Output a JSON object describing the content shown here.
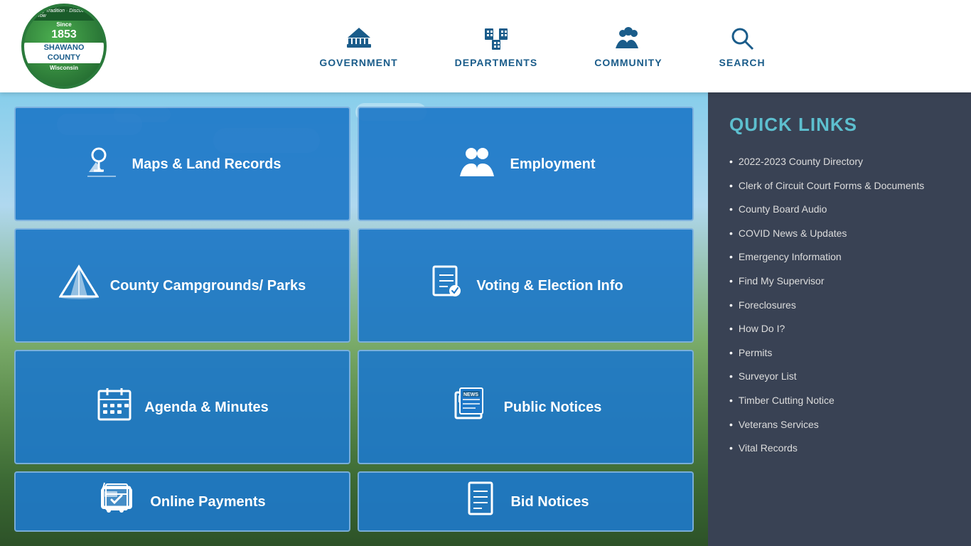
{
  "header": {
    "logo": {
      "since": "Since",
      "year": "1853",
      "county_name": "SHAWANO COUNTY",
      "state": "Wisconsin",
      "tagline": "Honoring Tradition · Discovering Tomorrow"
    },
    "nav": [
      {
        "id": "government",
        "label": "GOVERNMENT",
        "icon": "gov"
      },
      {
        "id": "departments",
        "label": "DEPARTMENTS",
        "icon": "dept"
      },
      {
        "id": "community",
        "label": "COMMUNITY",
        "icon": "comm"
      },
      {
        "id": "search",
        "label": "SEARCH",
        "icon": "search"
      }
    ]
  },
  "grid": {
    "tiles": [
      {
        "id": "maps-land-records",
        "label": "Maps & Land Records",
        "icon": "map"
      },
      {
        "id": "employment",
        "label": "Employment",
        "icon": "people"
      },
      {
        "id": "campgrounds",
        "label": "County Campgrounds/ Parks",
        "icon": "tent"
      },
      {
        "id": "voting",
        "label": "Voting & Election Info",
        "icon": "ballot"
      },
      {
        "id": "agenda",
        "label": "Agenda & Minutes",
        "icon": "calendar"
      },
      {
        "id": "public-notices",
        "label": "Public Notices",
        "icon": "news"
      },
      {
        "id": "online-payments",
        "label": "Online Payments",
        "icon": "cart"
      },
      {
        "id": "bid-notices",
        "label": "Bid Notices",
        "icon": "doc"
      }
    ]
  },
  "quick_links": {
    "title": "QUICK LINKS",
    "items": [
      {
        "id": "county-directory",
        "label": "2022-2023 County Directory"
      },
      {
        "id": "clerk-forms",
        "label": "Clerk of Circuit Court Forms & Documents"
      },
      {
        "id": "county-board-audio",
        "label": "County Board Audio"
      },
      {
        "id": "covid-news",
        "label": "COVID News & Updates"
      },
      {
        "id": "emergency-info",
        "label": "Emergency Information"
      },
      {
        "id": "find-supervisor",
        "label": "Find My Supervisor"
      },
      {
        "id": "foreclosures",
        "label": "Foreclosures"
      },
      {
        "id": "how-do-i",
        "label": "How Do I?"
      },
      {
        "id": "permits",
        "label": "Permits"
      },
      {
        "id": "surveyor-list",
        "label": "Surveyor List"
      },
      {
        "id": "timber-cutting",
        "label": "Timber Cutting Notice"
      },
      {
        "id": "veterans-services",
        "label": "Veterans Services"
      },
      {
        "id": "vital-records",
        "label": "Vital Records"
      }
    ]
  },
  "colors": {
    "nav_blue": "#1a5c8a",
    "tile_blue": "#1e78c8",
    "quick_link_teal": "#5dbfcf",
    "sidebar_bg": "rgba(30,40,60,0.88)"
  }
}
